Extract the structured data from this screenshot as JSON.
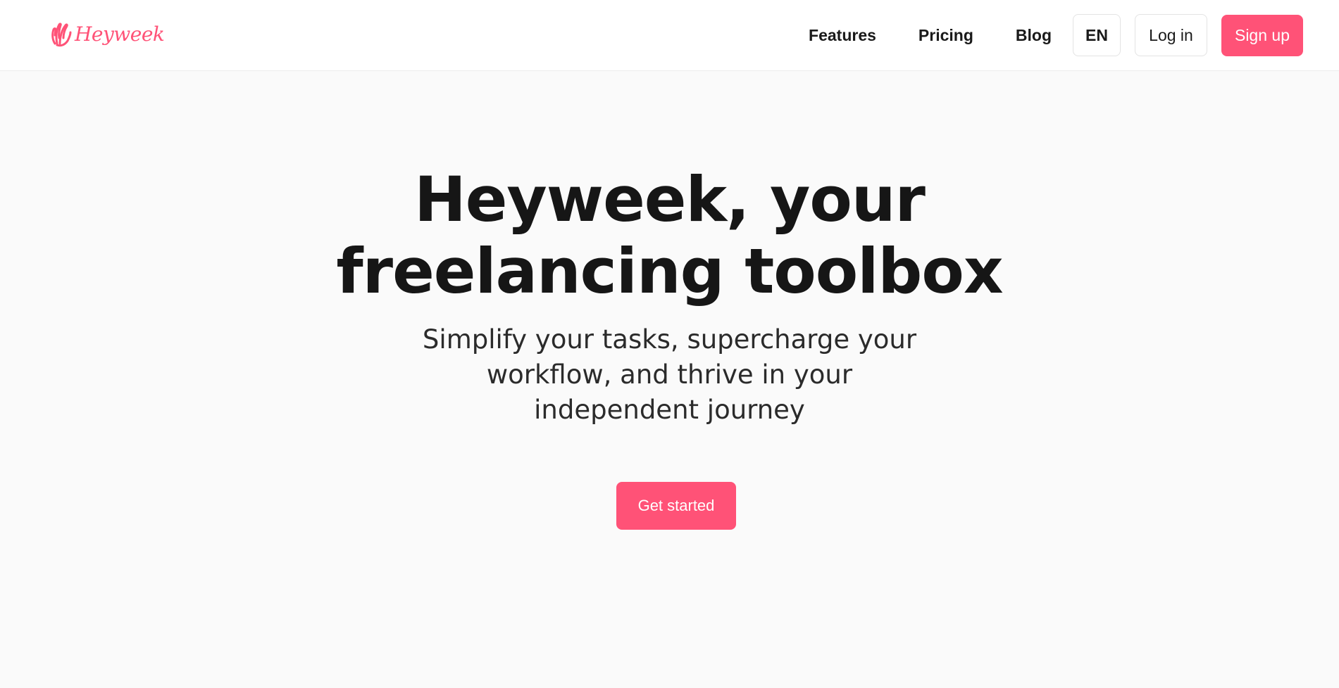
{
  "brand": {
    "name": "Heyweek",
    "accent_color": "#ff5277",
    "logo_icon": "waving-hand-icon"
  },
  "nav": {
    "links": [
      "Features",
      "Pricing",
      "Blog"
    ],
    "language": "EN",
    "login_label": "Log in",
    "signup_label": "Sign up"
  },
  "hero": {
    "title_line1": "Heyweek, your",
    "title_line2": "freelancing toolbox",
    "subtitle": "Simplify your tasks, supercharge your workflow, and thrive in your independent journey",
    "cta_label": "Get started"
  }
}
